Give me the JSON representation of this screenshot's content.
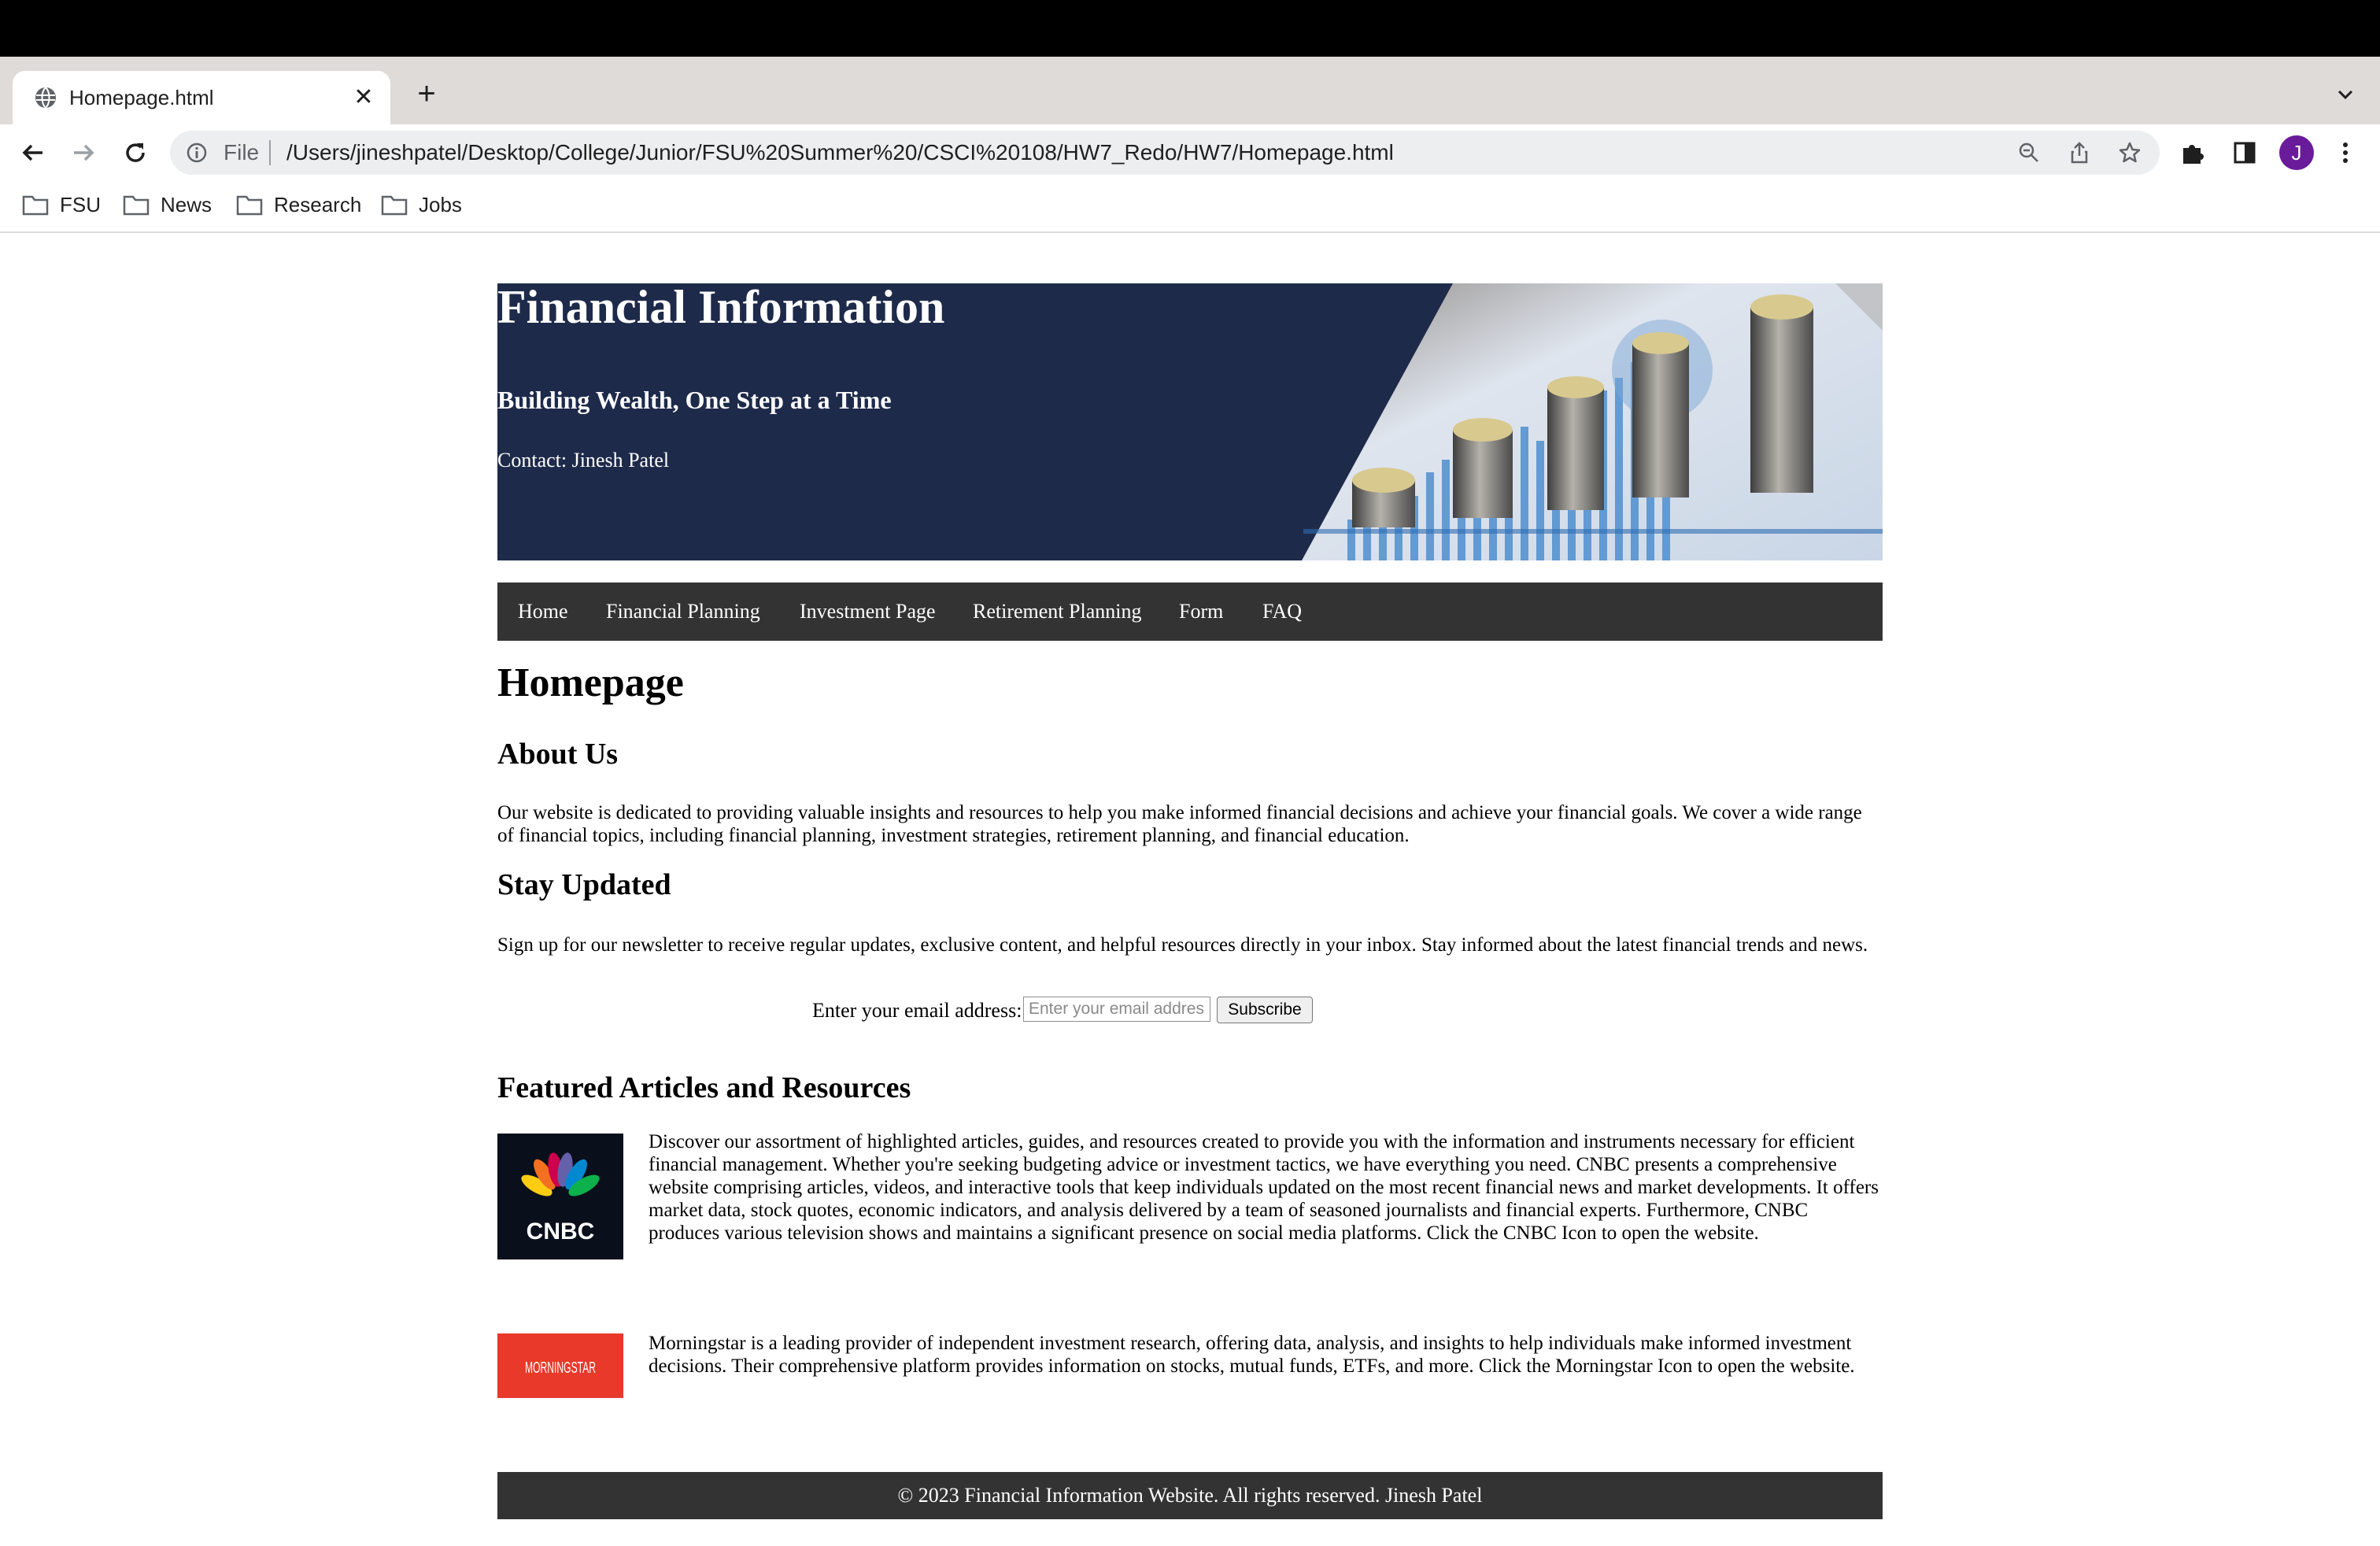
{
  "browser": {
    "tab_title": "Homepage.html",
    "new_tab_label": "+",
    "omnibox_scheme": "File",
    "url": "/Users/jineshpatel/Desktop/College/Junior/FSU%20Summer%20/CSCI%20108/HW7_Redo/HW7/Homepage.html",
    "avatar_initial": "J",
    "bookmarks": [
      "FSU",
      "News",
      "Research",
      "Jobs"
    ]
  },
  "header": {
    "title": "Financial Information",
    "subtitle": "Building Wealth, One Step at a Time",
    "contact": "Contact: Jinesh Patel"
  },
  "nav": {
    "items": [
      "Home",
      "Financial Planning",
      "Investment Page",
      "Retirement Planning",
      "Form",
      "FAQ"
    ]
  },
  "main": {
    "page_title": "Homepage",
    "about_heading": "About Us",
    "about_text": "Our website is dedicated to providing valuable insights and resources to help you make informed financial decisions and achieve your financial goals. We cover a wide range of financial topics, including financial planning, investment strategies, retirement planning, and financial education.",
    "stay_heading": "Stay Updated",
    "stay_text": "Sign up for our newsletter to receive regular updates, exclusive content, and helpful resources directly in your inbox. Stay informed about the latest financial trends and news.",
    "email_label": "Enter your email address:",
    "email_placeholder": "Enter your email address",
    "subscribe_label": "Subscribe",
    "featured_heading": "Featured Articles and Resources",
    "articles": [
      {
        "logo": "CNBC",
        "text": "Discover our assortment of highlighted articles, guides, and resources created to provide you with the information and instruments necessary for efficient financial management. Whether you're seeking budgeting advice or investment tactics, we have everything you need. CNBC presents a comprehensive website comprising articles, videos, and interactive tools that keep individuals updated on the most recent financial news and market developments. It offers market data, stock quotes, economic indicators, and analysis delivered by a team of seasoned journalists and financial experts. Furthermore, CNBC produces various television shows and maintains a significant presence on social media platforms. Click the CNBC Icon to open the website."
      },
      {
        "logo": "MORNINGSTAR",
        "text": "Morningstar is a leading provider of independent investment research, offering data, analysis, and insights to help individuals make informed investment decisions. Their comprehensive platform provides information on stocks, mutual funds, ETFs, and more. Click the Morningstar Icon to open the website."
      }
    ]
  },
  "footer": {
    "text": "© 2023 Financial Information Website. All rights reserved. Jinesh Patel"
  },
  "colors": {
    "banner_bg": "#1e2a4a",
    "nav_bg": "#333333",
    "avatar_bg": "#6a1b9a",
    "morningstar_red": "#e8392a"
  }
}
